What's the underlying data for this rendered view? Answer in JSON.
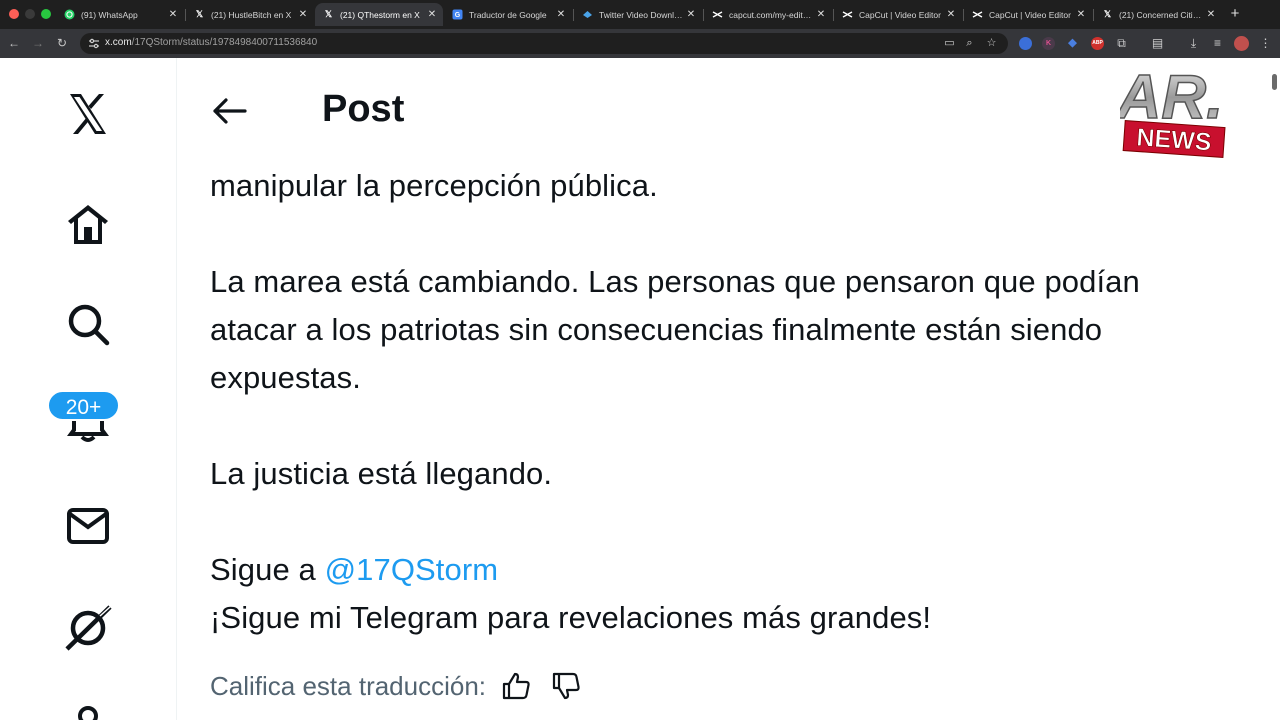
{
  "browser": {
    "tabs": [
      {
        "label": "(91) WhatsApp",
        "icon": "whatsapp-icon"
      },
      {
        "label": "(21) HustleBitch en X",
        "icon": "x-icon"
      },
      {
        "label": "(21) QThestorm en X",
        "icon": "x-icon"
      },
      {
        "label": "Traductor de Google",
        "icon": "google-translate-icon"
      },
      {
        "label": "Twitter Video Downlo...",
        "icon": "downloader-icon"
      },
      {
        "label": "capcut.com/my-edit?...",
        "icon": "capcut-icon"
      },
      {
        "label": "CapCut | Video Editor",
        "icon": "capcut-icon"
      },
      {
        "label": "CapCut | Video Editor",
        "icon": "capcut-icon"
      },
      {
        "label": "(21) Concerned Citize...",
        "icon": "x-icon"
      }
    ],
    "url_domain": "x.com",
    "url_path": "/17QStorm/status/1978498400711536840",
    "colors": {
      "chrome_dark": "#1f1f1f",
      "chrome_toolbar": "#35363a"
    }
  },
  "nav": {
    "items": [
      {
        "name": "x-logo-icon"
      },
      {
        "name": "home-icon"
      },
      {
        "name": "search-icon"
      },
      {
        "name": "notifications-icon"
      },
      {
        "name": "messages-icon"
      },
      {
        "name": "grok-icon"
      },
      {
        "name": "profile-icon"
      }
    ],
    "notification_badge": "20+"
  },
  "header": {
    "title": "Post"
  },
  "tweet": {
    "line1": "manipular la percepción pública.",
    "para2_line1": "La marea está cambiando. Las personas que pensaron que podían",
    "para2_line2": "atacar a los patriotas sin consecuencias finalmente están siendo",
    "para2_line3": "expuestas.",
    "para3": "La justicia está llegando.",
    "follow_prefix": "Sigue a ",
    "mention": "@17QStorm",
    "telegram": "¡Sigue mi Telegram para revelaciones más grandes!"
  },
  "translation": {
    "rate_label": "Califica esta traducción:"
  },
  "watermark": {
    "text_top": "AR.",
    "text_bottom": "NEWS"
  },
  "colors": {
    "accent": "#1d9bf0",
    "text": "#0f1419",
    "secondary": "#536471"
  }
}
